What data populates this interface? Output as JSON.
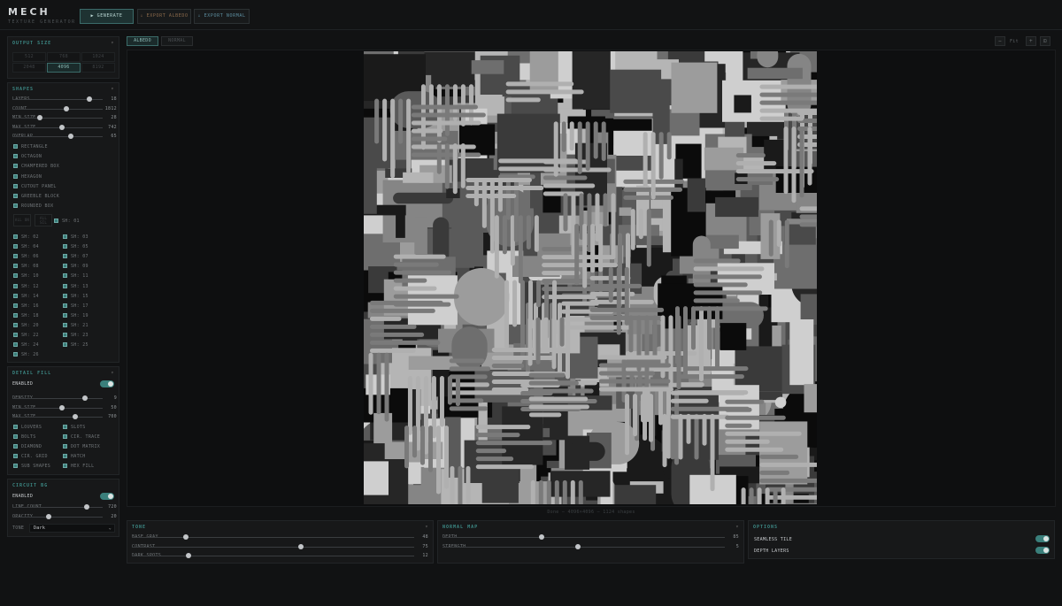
{
  "app": {
    "title": "MECH",
    "subtitle": "TEXTURE GENERATOR"
  },
  "toolbar": {
    "generate": "▶ GENERATE",
    "export_albedo": "↓ EXPORT ALBEDO",
    "export_normal": "↓ EXPORT NORMAL"
  },
  "output_size": {
    "title": "OUTPUT SIZE",
    "options": [
      "512",
      "768",
      "1024",
      "2048",
      "4096",
      "8192"
    ],
    "selected": "4096"
  },
  "shapes": {
    "title": "SHAPES",
    "sliders": [
      {
        "label": "LAYERS",
        "value": "18",
        "level": 0.85
      },
      {
        "label": "COUNT",
        "value": "1812",
        "level": 0.6
      },
      {
        "label": "MIN SIZE",
        "value": "28",
        "level": 0.3
      },
      {
        "label": "MAX SIZE",
        "value": "742",
        "level": 0.55
      },
      {
        "label": "OVERLAP",
        "value": "65",
        "level": 0.65
      }
    ],
    "types": [
      "RECTANGLE",
      "OCTAGON",
      "CHAMFERED BOX",
      "HEXAGON",
      "CUTOUT PANEL",
      "GREEBLE BLOCK",
      "ROUNDED BOX"
    ],
    "all_on": "ALL ON",
    "all_sil": "ALL SIL",
    "silhouettes_first": "SH: 01",
    "silhouettes": [
      "SH: 02",
      "SH: 03",
      "SH: 04",
      "SH: 05",
      "SH: 06",
      "SH: 07",
      "SH: 08",
      "SH: 09",
      "SH: 10",
      "SH: 11",
      "SH: 12",
      "SH: 13",
      "SH: 14",
      "SH: 15",
      "SH: 16",
      "SH: 17",
      "SH: 18",
      "SH: 19",
      "SH: 20",
      "SH: 21",
      "SH: 22",
      "SH: 23",
      "SH: 24",
      "SH: 25",
      "SH: 26"
    ]
  },
  "detail_fill": {
    "title": "DETAIL FILL",
    "enabled_label": "ENABLED",
    "sliders": [
      {
        "label": "DENSITY",
        "value": "9",
        "level": 0.8
      },
      {
        "label": "MIN SIZE",
        "value": "50",
        "level": 0.55
      },
      {
        "label": "MAX SIZE",
        "value": "700",
        "level": 0.7
      }
    ],
    "types": [
      "LOUVERS",
      "SLOTS",
      "BOLTS",
      "CIR. TRACE",
      "DIAMOND",
      "DOT MATRIX",
      "CIR. GRID",
      "HATCH",
      "SUB SHAPES",
      "HEX FILL"
    ]
  },
  "circuit_bg": {
    "title": "CIRCUIT BG",
    "enabled_label": "ENABLED",
    "sliders": [
      {
        "label": "LINE COUNT",
        "value": "720",
        "level": 0.82
      },
      {
        "label": "OPACITY",
        "value": "20",
        "level": 0.4
      }
    ],
    "tone_label": "TONE",
    "tone_value": "Dark"
  },
  "view": {
    "tab_albedo": "ALBEDO",
    "tab_normal": "NORMAL",
    "zoom_minus": "−",
    "zoom_level": "Fit",
    "zoom_plus": "+",
    "zoom_fit": "⊡"
  },
  "status": "Done — 4096×4096 — 1124 shapes",
  "tone": {
    "title": "TONE",
    "sliders": [
      {
        "label": "BASE GRAY",
        "value": "48",
        "level": 0.19
      },
      {
        "label": "CONTRAST",
        "value": "75",
        "level": 0.6
      },
      {
        "label": "DARK SPOTS",
        "value": "12",
        "level": 0.2
      }
    ]
  },
  "normal_map": {
    "title": "NORMAL MAP",
    "sliders": [
      {
        "label": "DEPTH",
        "value": "85",
        "level": 0.35
      },
      {
        "label": "STRENGTH",
        "value": "5",
        "level": 0.48
      }
    ]
  },
  "options": {
    "title": "OPTIONS",
    "seamless": "SEAMLESS TILE",
    "depth_layers": "DEPTH LAYERS"
  },
  "colors": {
    "accent": "#3a7f7b",
    "bg": "#111213",
    "panel": "#171819"
  }
}
